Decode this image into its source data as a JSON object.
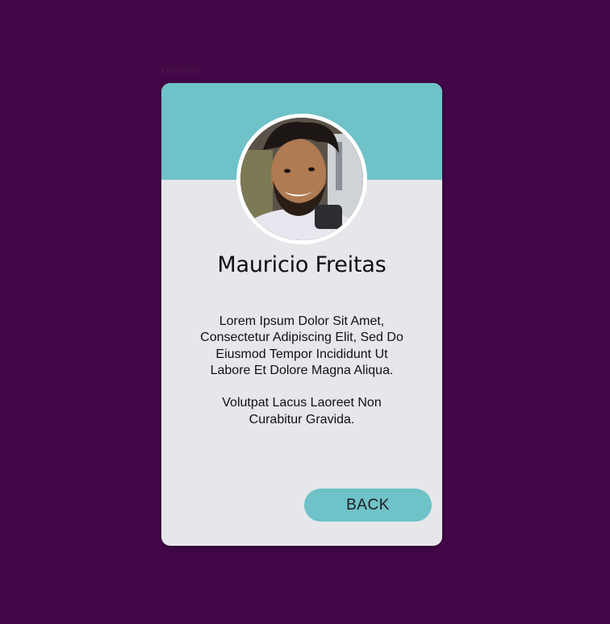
{
  "frame": {
    "label": "Overview"
  },
  "profile": {
    "name": "Mauricio Freitas",
    "bio_paragraphs": [
      "Lorem Ipsum Dolor Sit Amet, Consectetur Adipiscing Elit, Sed Do Eiusmod  Tempor Incididunt Ut Labore Et Dolore Magna Aliqua.",
      "Volutpat Lacus  Laoreet Non Curabitur Gravida."
    ]
  },
  "actions": {
    "back_label": "BACK"
  },
  "colors": {
    "background": "#420746",
    "card": "#e6e7ea",
    "accent": "#6ec2c8",
    "text": "#111114"
  }
}
